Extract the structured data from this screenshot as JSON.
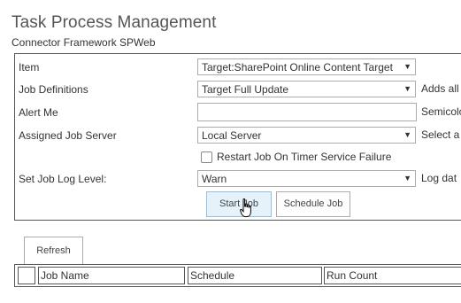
{
  "page": {
    "title": "Task Process Management",
    "subtitle": "Connector Framework SPWeb"
  },
  "form": {
    "item_label": "Item",
    "item_value": "Target:SharePoint Online Content Target",
    "job_definitions_label": "Job Definitions",
    "job_definitions_value": "Target Full Update",
    "job_definitions_hint": "Adds all",
    "alert_me_label": "Alert Me",
    "alert_me_value": "",
    "alert_me_hint": "Semicolo",
    "assigned_job_server_label": "Assigned Job Server",
    "assigned_job_server_value": "Local Server",
    "assigned_job_server_hint": "Select a",
    "restart_job_label": "Restart Job On Timer Service Failure",
    "restart_job_checked": false,
    "log_level_label": "Set Job Log Level:",
    "log_level_value": "Warn",
    "log_level_hint": "Log dat",
    "dropdown_arrow": "▼"
  },
  "buttons": {
    "start_job": "Start Job",
    "schedule_job": "Schedule Job",
    "refresh": "Refresh"
  },
  "grid": {
    "columns": [
      "",
      "Job Name",
      "Schedule",
      "Run Count"
    ]
  },
  "colors": {
    "border": "#555555",
    "input_border": "#ababab",
    "hover_button_bg": "#e6f2fa",
    "hover_button_border": "#92c0e0"
  },
  "icons": {
    "cursor": "hand-pointer-icon",
    "dropdown": "chevron-down-icon"
  }
}
